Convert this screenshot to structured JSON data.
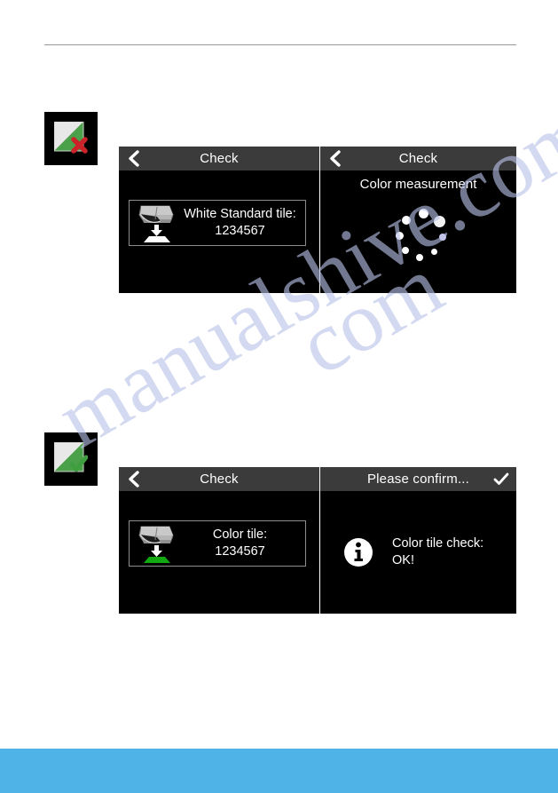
{
  "page": {
    "background_color": "#ffffff",
    "rule_color": "#9a9a9a",
    "footer_color": "#4fb3e8",
    "watermark_line_1": "manualshive.com",
    "watermark_line_2": "com"
  },
  "thumbnails": [
    {
      "name": "white-standard-tile-fail-thumb",
      "status": "fail",
      "marker": "red-x",
      "tile_color": "#e8e8e8",
      "accent_color": "#4aa14a",
      "marker_color": "#cc2229"
    },
    {
      "name": "color-tile-ok-thumb",
      "status": "ok",
      "marker": "green-check",
      "tile_color": "#e8e8e8",
      "accent_color": "#4aa14a",
      "marker_color": "#3f9e3f"
    }
  ],
  "screens": [
    {
      "id": "check-white-standard",
      "titlebar": {
        "label": "Check",
        "back_icon": "chevron-left-icon",
        "confirm_icon": null,
        "background": "#3b3b3b"
      },
      "card": {
        "icon": "instrument-on-white-tile-icon",
        "tile_fill": "#ffffff",
        "label_line_1": "White Standard tile:",
        "label_line_2": "1234567"
      }
    },
    {
      "id": "check-color-measurement",
      "titlebar": {
        "label": "Check",
        "back_icon": "chevron-left-icon",
        "confirm_icon": null,
        "background": "#3b3b3b"
      },
      "measurement_label": "Color measurement",
      "spinner": {
        "icon": "loading-spinner-icon",
        "dot_count": 8,
        "color": "#ffffff"
      }
    },
    {
      "id": "check-color-tile",
      "titlebar": {
        "label": "Check",
        "back_icon": "chevron-left-icon",
        "confirm_icon": null,
        "background": "#3b3b3b"
      },
      "card": {
        "icon": "instrument-on-color-tile-icon",
        "tile_fill": "#11a811",
        "label_line_1": "Color tile:",
        "label_line_2": "1234567"
      }
    },
    {
      "id": "please-confirm",
      "titlebar": {
        "label": "Please confirm...",
        "back_icon": null,
        "confirm_icon": "checkmark-icon",
        "background": "#3b3b3b"
      },
      "message": {
        "icon": "info-icon",
        "line_1": "Color tile check:",
        "line_2": "OK!"
      }
    }
  ]
}
